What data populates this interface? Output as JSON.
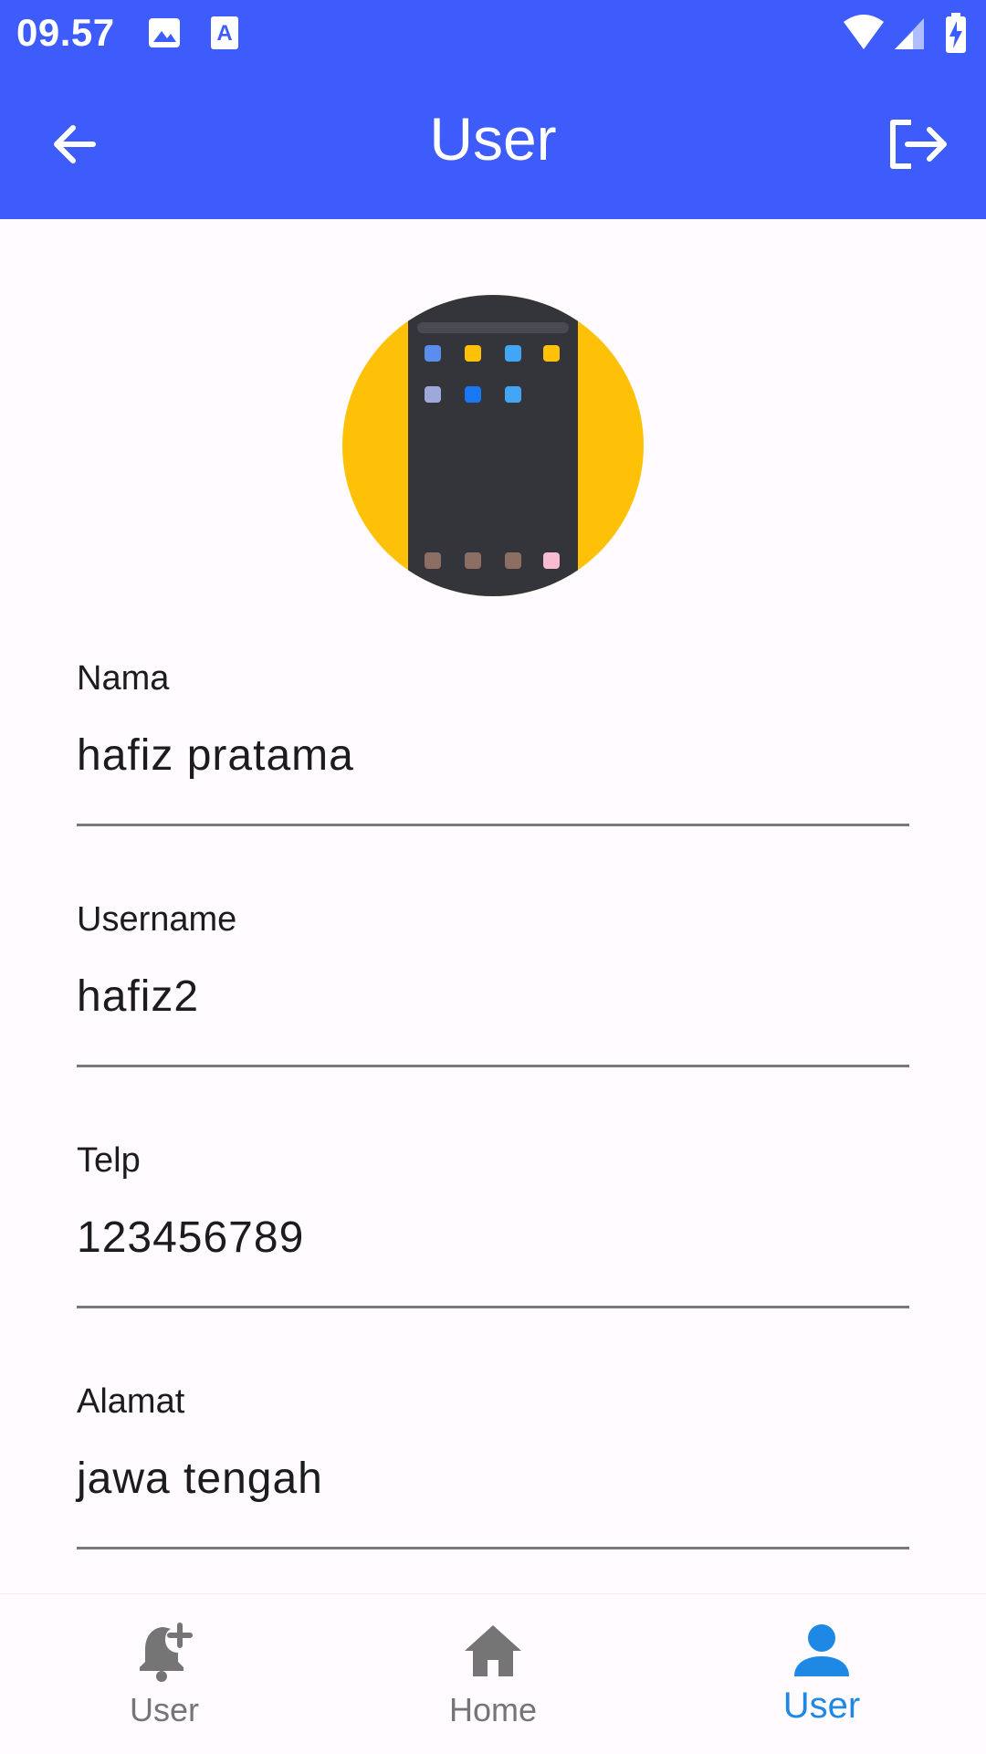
{
  "status_bar": {
    "time": "09.57",
    "icons": [
      "image-icon",
      "text-a-icon",
      "wifi-icon",
      "signal-icon",
      "battery-charging-icon"
    ],
    "color": "#3d5cfb"
  },
  "app_bar": {
    "title": "User",
    "back_icon": "arrow-back-icon",
    "logout_icon": "logout-icon"
  },
  "profile": {
    "avatar_bg": "#ffc107",
    "fields": [
      {
        "label": "Nama",
        "value": "hafiz pratama"
      },
      {
        "label": "Username",
        "value": "hafiz2"
      },
      {
        "label": "Telp",
        "value": "123456789"
      },
      {
        "label": "Alamat",
        "value": "jawa tengah"
      }
    ]
  },
  "bottom_nav": {
    "items": [
      {
        "label": "User",
        "icon": "notification-add-icon",
        "active": false
      },
      {
        "label": "Home",
        "icon": "home-icon",
        "active": false
      },
      {
        "label": "User",
        "icon": "person-icon",
        "active": true
      }
    ],
    "active_color": "#1e88e5",
    "inactive_color": "#757575"
  }
}
